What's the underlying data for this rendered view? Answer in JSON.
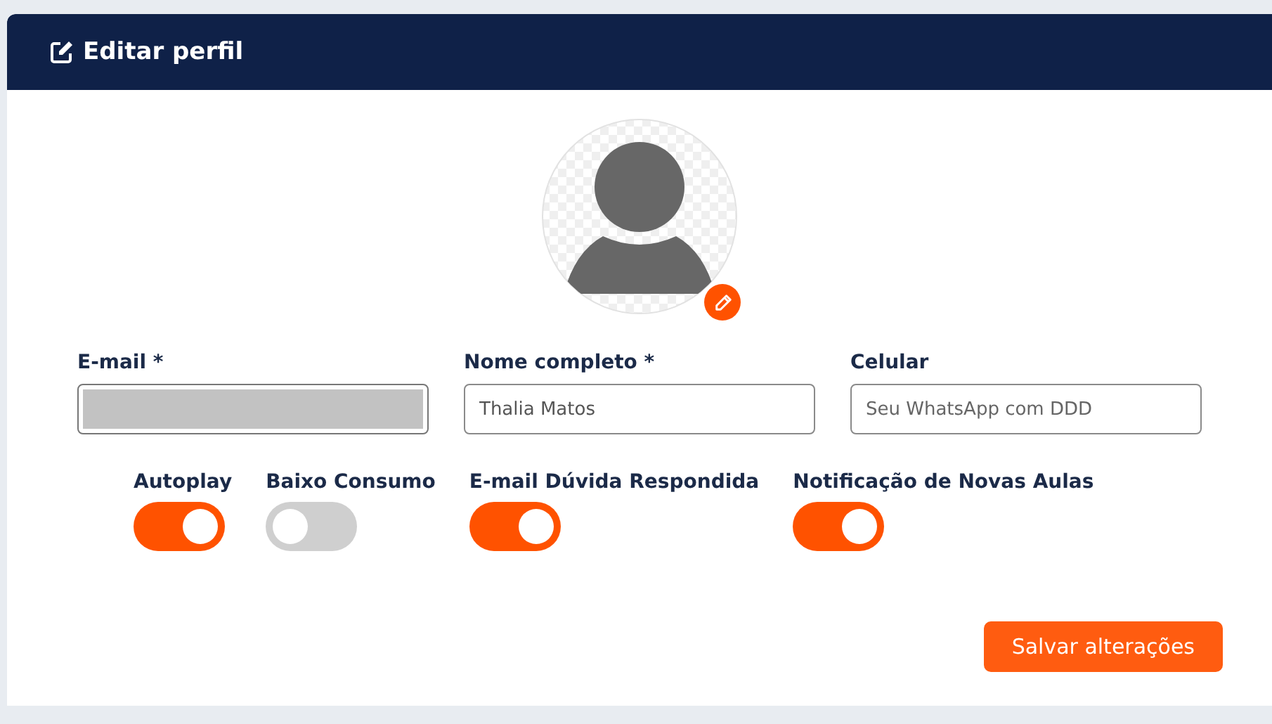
{
  "header": {
    "title": "Editar perfil"
  },
  "fields": [
    {
      "label": "E-mail *",
      "kind": "redacted"
    },
    {
      "label": "Nome completo *",
      "kind": "text",
      "value": "Thalia Matos"
    },
    {
      "label": "Celular",
      "kind": "text",
      "placeholder": "Seu WhatsApp com DDD"
    }
  ],
  "toggles": [
    {
      "label": "Autoplay",
      "on": true
    },
    {
      "label": "Baixo Consumo",
      "on": false
    },
    {
      "label": "E-mail Dúvida Respondida",
      "on": true
    },
    {
      "label": "Notificação de Novas Aulas",
      "on": true
    }
  ],
  "buttons": [
    "Salvar alterações"
  ]
}
